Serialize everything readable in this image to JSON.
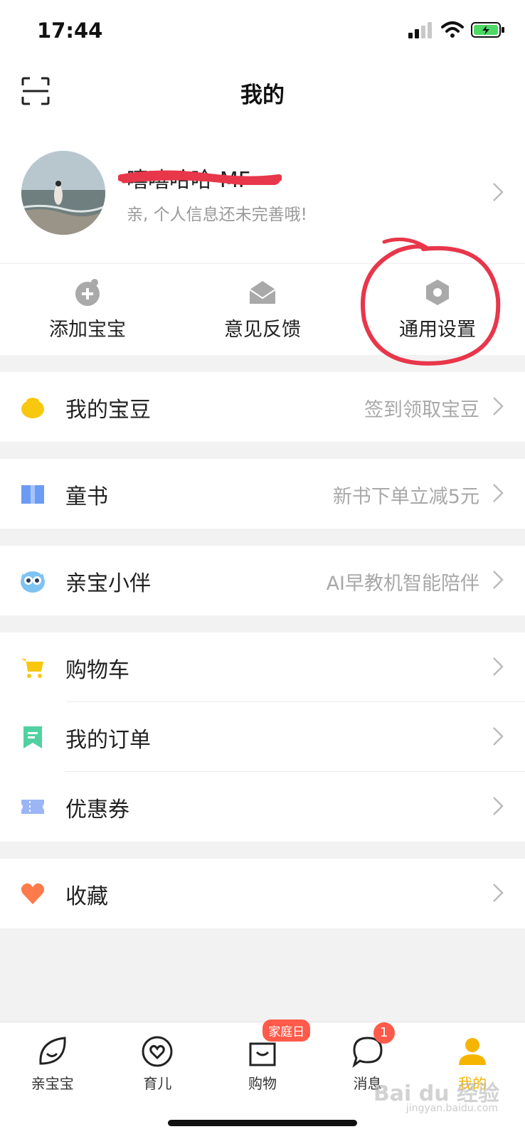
{
  "status": {
    "time": "17:44"
  },
  "header": {
    "title": "我的"
  },
  "profile": {
    "name": "嘻嘻哈哈-MF",
    "subtitle": "亲, 个人信息还未完善哦!"
  },
  "quick_actions": [
    {
      "label": "添加宝宝",
      "icon": "add-baby-icon"
    },
    {
      "label": "意见反馈",
      "icon": "mail-icon"
    },
    {
      "label": "通用设置",
      "icon": "settings-icon"
    }
  ],
  "menu": {
    "beans": {
      "label": "我的宝豆",
      "hint": "签到领取宝豆"
    },
    "books": {
      "label": "童书",
      "hint": "新书下单立减5元"
    },
    "companion": {
      "label": "亲宝小伴",
      "hint": "AI早教机智能陪伴"
    },
    "cart": {
      "label": "购物车"
    },
    "orders": {
      "label": "我的订单"
    },
    "coupons": {
      "label": "优惠券"
    },
    "favorites": {
      "label": "收藏"
    }
  },
  "tabs": [
    {
      "label": "亲宝宝"
    },
    {
      "label": "育儿"
    },
    {
      "label": "购物",
      "badge": "家庭日"
    },
    {
      "label": "消息",
      "badge": "1"
    },
    {
      "label": "我的"
    }
  ],
  "watermark": {
    "brand": "Bai du 经验",
    "url": "jingyan.baidu.com"
  },
  "colors": {
    "accent": "#f5b400",
    "badge": "#ff5a4a",
    "annotation": "#e8364a"
  }
}
